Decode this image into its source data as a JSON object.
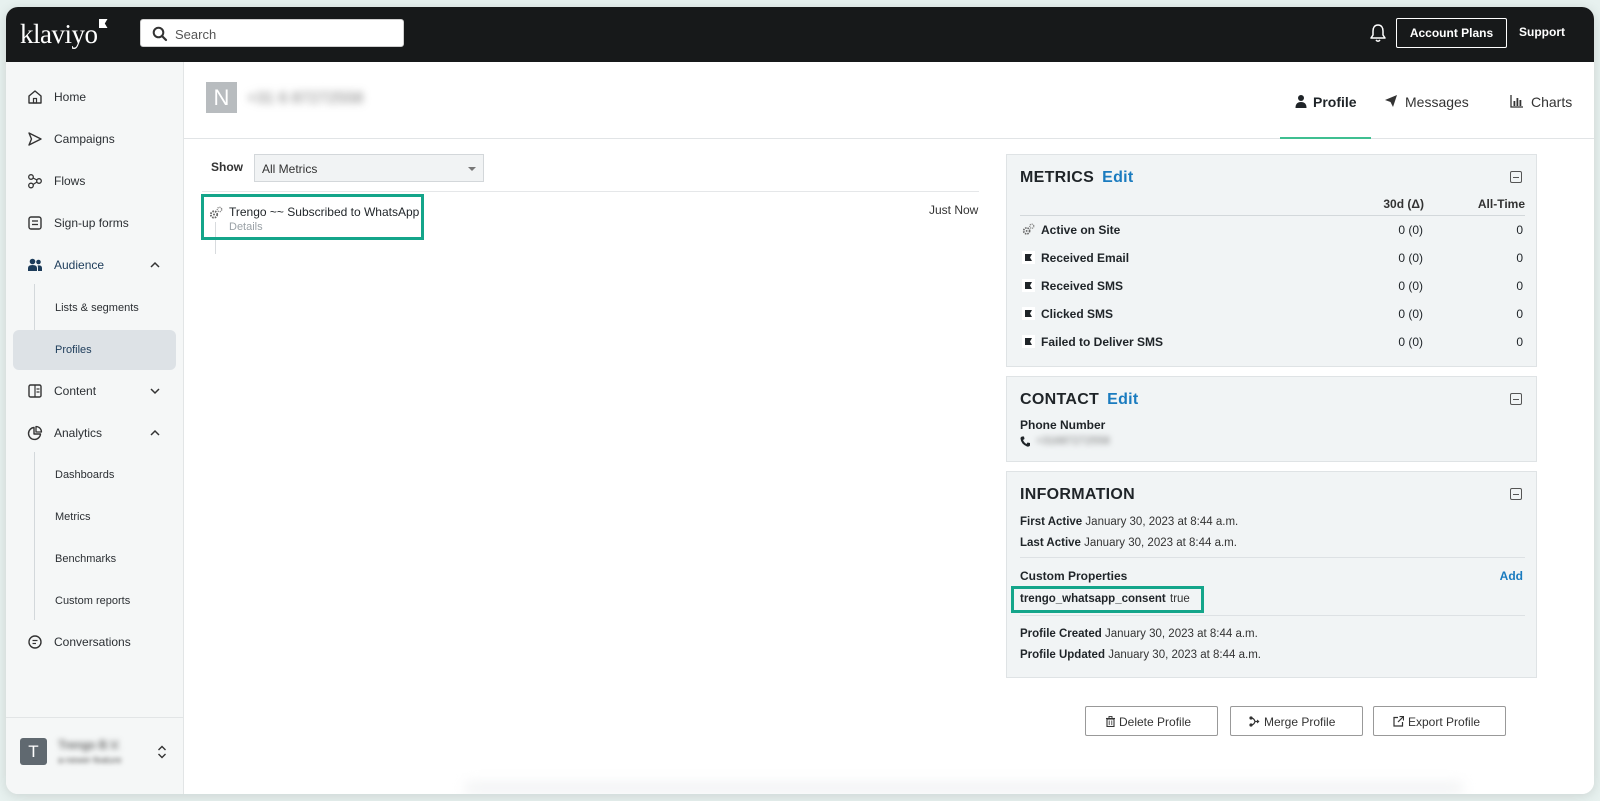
{
  "app": {
    "logo": "klaviyo"
  },
  "header": {
    "search_placeholder": "Search",
    "account_plans": "Account Plans",
    "support": "Support"
  },
  "sidebar": {
    "items": [
      {
        "label": "Home",
        "icon": "home-icon"
      },
      {
        "label": "Campaigns",
        "icon": "send-icon"
      },
      {
        "label": "Flows",
        "icon": "flows-icon"
      },
      {
        "label": "Sign-up forms",
        "icon": "form-icon"
      },
      {
        "label": "Audience",
        "icon": "audience-icon",
        "expanded": true
      },
      {
        "label": "Content",
        "icon": "content-icon",
        "expanded": false
      },
      {
        "label": "Analytics",
        "icon": "analytics-icon",
        "expanded": true
      },
      {
        "label": "Conversations",
        "icon": "chat-icon"
      }
    ],
    "audience_sub": [
      "Lists & segments",
      "Profiles"
    ],
    "analytics_sub": [
      "Dashboards",
      "Metrics",
      "Benchmarks",
      "Custom reports"
    ],
    "selected": "Profiles",
    "org": {
      "avatar": "T",
      "name": "Trengo B.V.",
      "sub": "a-newer-feature"
    }
  },
  "profile": {
    "avatar": "N",
    "name": "+31 6 87272558",
    "tabs": [
      {
        "label": "Profile",
        "icon": "user-icon",
        "active": true
      },
      {
        "label": "Messages",
        "icon": "paper-plane-icon",
        "active": false
      },
      {
        "label": "Charts",
        "icon": "bar-chart-icon",
        "active": false
      }
    ]
  },
  "feed": {
    "show_label": "Show",
    "filter_value": "All Metrics",
    "events": [
      {
        "title": "Trengo ~~ Subscribed to WhatsApp",
        "details": "Details",
        "time": "Just Now"
      }
    ]
  },
  "metrics": {
    "title": "METRICS",
    "edit": "Edit",
    "col_30d": "30d (Δ)",
    "col_all": "All-Time",
    "rows": [
      {
        "name": "Active on Site",
        "d30": "0 (0)",
        "all": "0",
        "icon": "gears-icon"
      },
      {
        "name": "Received Email",
        "d30": "0 (0)",
        "all": "0",
        "icon": "flag-icon"
      },
      {
        "name": "Received SMS",
        "d30": "0 (0)",
        "all": "0",
        "icon": "flag-icon"
      },
      {
        "name": "Clicked SMS",
        "d30": "0 (0)",
        "all": "0",
        "icon": "flag-icon"
      },
      {
        "name": "Failed to Deliver SMS",
        "d30": "0 (0)",
        "all": "0",
        "icon": "flag-icon"
      }
    ]
  },
  "contact": {
    "title": "CONTACT",
    "edit": "Edit",
    "phone_label": "Phone Number",
    "phone_value": "+31687272558"
  },
  "information": {
    "title": "INFORMATION",
    "first_active_label": "First Active",
    "first_active": "January 30, 2023 at 8:44 a.m.",
    "last_active_label": "Last Active",
    "last_active": "January 30, 2023 at 8:44 a.m.",
    "custom_props_label": "Custom Properties",
    "add": "Add",
    "consent_key": "trengo_whatsapp_consent",
    "consent_value": "true",
    "created_label": "Profile Created",
    "created": "January 30, 2023 at 8:44 a.m.",
    "updated_label": "Profile Updated",
    "updated": "January 30, 2023 at 8:44 a.m."
  },
  "actions": {
    "delete": "Delete Profile",
    "merge": "Merge Profile",
    "export": "Export Profile"
  },
  "colors": {
    "topbar": "#17191a",
    "highlight": "#14a58a",
    "link": "#1a7bbf",
    "active_tab": "#3fbf91"
  }
}
